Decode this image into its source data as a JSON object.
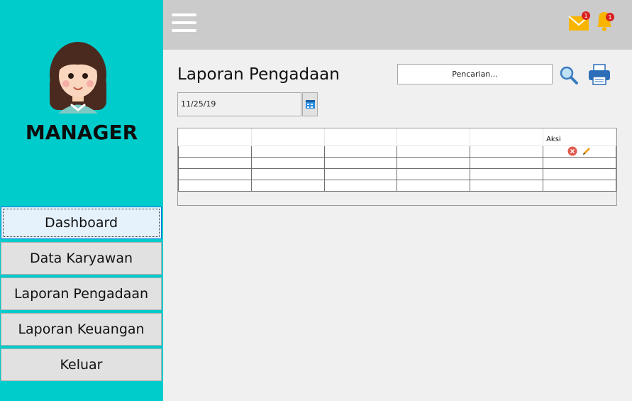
{
  "sidebar": {
    "role_title": "MANAGER",
    "menu": [
      {
        "label": "Dashboard",
        "active": true
      },
      {
        "label": "Data Karyawan"
      },
      {
        "label": "Laporan Pengadaan"
      },
      {
        "label": "Laporan Keuangan"
      },
      {
        "label": "Keluar"
      }
    ]
  },
  "topbar": {
    "mail_badge": "1",
    "bell_badge": "1"
  },
  "main": {
    "title": "Laporan Pengadaan",
    "search_placeholder": "Pencarian...",
    "date_value": "11/25/19",
    "table": {
      "columns": [
        "",
        "",
        "",
        "",
        "",
        "Aksi"
      ],
      "rows": [
        [
          "",
          "",
          "",
          "",
          "",
          ""
        ],
        [
          "",
          "",
          "",
          "",
          "",
          ""
        ],
        [
          "",
          "",
          "",
          "",
          "",
          ""
        ],
        [
          "",
          "",
          "",
          "",
          "",
          ""
        ]
      ]
    }
  },
  "colors": {
    "sidebar_bg": "#00cccc",
    "topbar_bg": "#cbcbcb",
    "badge_red": "#d92020",
    "icon_yellow": "#f7b500"
  }
}
